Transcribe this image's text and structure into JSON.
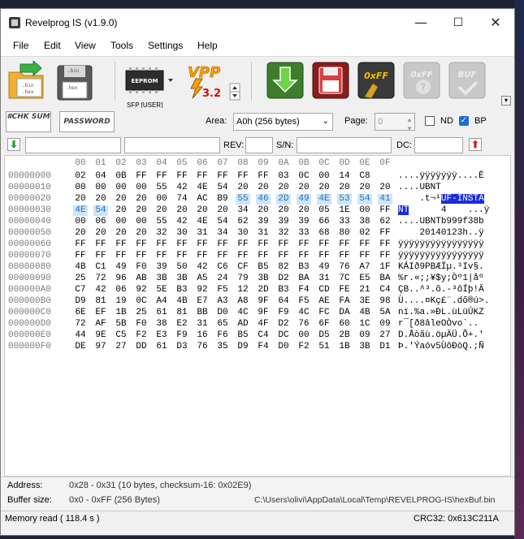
{
  "window": {
    "title": "Revelprog IS (v1.9.0)",
    "minimize": "—",
    "maximize": "☐",
    "close": "✕"
  },
  "menu": [
    "File",
    "Edit",
    "View",
    "Tools",
    "Settings",
    "Help"
  ],
  "toolbar": {
    "open_text": "Open",
    "save_text": "Save",
    "chip_label": "EEPROM",
    "chip_selection": "SFP [USER]",
    "vpp_label": "VPP",
    "vpp_value": "3.2",
    "ff_label": "0xFF",
    "ffd_label": "0xFF",
    "buf_label": "BUF"
  },
  "controls": {
    "checksum_btn": "#CHK SUM",
    "password_btn": "PASSWORD",
    "area_label": "Area:",
    "area_value": "A0h (256 bytes)",
    "page_label": "Page:",
    "page_value": "0",
    "nd_label": "ND",
    "bp_label": "BP",
    "rev_label": "REV:",
    "sn_label": "S/N:",
    "dc_label": "DC:"
  },
  "hex": {
    "columns": [
      "00",
      "01",
      "02",
      "03",
      "04",
      "05",
      "06",
      "07",
      "08",
      "09",
      "0A",
      "0B",
      "0C",
      "0D",
      "0E",
      "0F"
    ],
    "selection_start": 40,
    "selection_end": 49,
    "rows": [
      {
        "addr": "00000000",
        "bytes": [
          "02",
          "04",
          "0B",
          "FF",
          "FF",
          "FF",
          "FF",
          "FF",
          "FF",
          "FF",
          "03",
          "0C",
          "00",
          "14",
          "C8",
          ""
        ]
      },
      {
        "addr": "00000010",
        "bytes": [
          "00",
          "00",
          "00",
          "00",
          "55",
          "42",
          "4E",
          "54",
          "20",
          "20",
          "20",
          "20",
          "20",
          "20",
          "20",
          "20"
        ]
      },
      {
        "addr": "00000020",
        "bytes": [
          "20",
          "20",
          "20",
          "20",
          "00",
          "74",
          "AC",
          "B9",
          "55",
          "46",
          "2D",
          "49",
          "4E",
          "53",
          "54",
          "41"
        ]
      },
      {
        "addr": "00000030",
        "bytes": [
          "4E",
          "54",
          "20",
          "20",
          "20",
          "20",
          "20",
          "20",
          "34",
          "20",
          "20",
          "20",
          "05",
          "1E",
          "00",
          "FF"
        ]
      },
      {
        "addr": "00000040",
        "bytes": [
          "00",
          "06",
          "00",
          "00",
          "55",
          "42",
          "4E",
          "54",
          "62",
          "39",
          "39",
          "39",
          "66",
          "33",
          "38",
          "62"
        ]
      },
      {
        "addr": "00000050",
        "bytes": [
          "20",
          "20",
          "20",
          "20",
          "32",
          "30",
          "31",
          "34",
          "30",
          "31",
          "32",
          "33",
          "68",
          "80",
          "02",
          "FF"
        ]
      },
      {
        "addr": "00000060",
        "bytes": [
          "FF",
          "FF",
          "FF",
          "FF",
          "FF",
          "FF",
          "FF",
          "FF",
          "FF",
          "FF",
          "FF",
          "FF",
          "FF",
          "FF",
          "FF",
          "FF"
        ]
      },
      {
        "addr": "00000070",
        "bytes": [
          "FF",
          "FF",
          "FF",
          "FF",
          "FF",
          "FF",
          "FF",
          "FF",
          "FF",
          "FF",
          "FF",
          "FF",
          "FF",
          "FF",
          "FF",
          "FF"
        ]
      },
      {
        "addr": "00000080",
        "bytes": [
          "4B",
          "C1",
          "49",
          "F0",
          "39",
          "50",
          "42",
          "C6",
          "CF",
          "B5",
          "82",
          "B3",
          "49",
          "76",
          "A7",
          "1F"
        ]
      },
      {
        "addr": "00000090",
        "bytes": [
          "25",
          "72",
          "96",
          "AB",
          "3B",
          "3B",
          "A5",
          "24",
          "79",
          "3B",
          "D2",
          "BA",
          "31",
          "7C",
          "E5",
          "BA"
        ]
      },
      {
        "addr": "000000A0",
        "bytes": [
          "C7",
          "42",
          "06",
          "92",
          "5E",
          "B3",
          "92",
          "F5",
          "12",
          "2D",
          "B3",
          "F4",
          "CD",
          "FE",
          "21",
          "C4"
        ]
      },
      {
        "addr": "000000B0",
        "bytes": [
          "D9",
          "81",
          "19",
          "0C",
          "A4",
          "4B",
          "E7",
          "A3",
          "A8",
          "9F",
          "64",
          "F5",
          "AE",
          "FA",
          "3E",
          "98"
        ]
      },
      {
        "addr": "000000C0",
        "bytes": [
          "6E",
          "EF",
          "1B",
          "25",
          "61",
          "81",
          "BB",
          "D0",
          "4C",
          "9F",
          "F9",
          "4C",
          "FC",
          "DA",
          "4B",
          "5A"
        ]
      },
      {
        "addr": "000000D0",
        "bytes": [
          "72",
          "AF",
          "5B",
          "F0",
          "38",
          "E2",
          "31",
          "65",
          "AD",
          "4F",
          "D2",
          "76",
          "6F",
          "60",
          "1C",
          "09"
        ]
      },
      {
        "addr": "000000E0",
        "bytes": [
          "44",
          "9E",
          "C5",
          "F2",
          "E3",
          "F9",
          "16",
          "F6",
          "B5",
          "C4",
          "DC",
          "00",
          "D5",
          "2B",
          "09",
          "27"
        ]
      },
      {
        "addr": "000000F0",
        "bytes": [
          "DE",
          "97",
          "27",
          "DD",
          "61",
          "D3",
          "76",
          "35",
          "D9",
          "F4",
          "D0",
          "F2",
          "51",
          "1B",
          "3B",
          "D1"
        ]
      }
    ],
    "ascii": [
      "....ÿÿÿÿÿÿÿ....È",
      "....UBNT        ",
      "    .t¬¹UF-INSTA",
      "NT      4    ...ÿ",
      "....UBNTb999f38b",
      "    20140123h..ÿ",
      "ÿÿÿÿÿÿÿÿÿÿÿÿÿÿÿÿ",
      "ÿÿÿÿÿÿÿÿÿÿÿÿÿÿÿÿ",
      "KÁIð9PBÆÏµ.³Iv§.",
      "%r.«;;¥$y;Òº1|åº",
      "ÇB..^³.õ.-³ôÍþ!Ä",
      "Ù....¤Kç£¨.dõ®ú>.",
      "nï.%a.»ÐL.ùLüÚKZ",
      "r¯[ð8âle­OÒvo`..",
      "D.Åòãù.öµÄÜ.Õ+.'",
      "Þ.'Ýaóv5ÙôÐòQ.;Ñ"
    ]
  },
  "info": {
    "address_label": "Address:",
    "address_value": "0x28 - 0x31 (10 bytes, checksum-16: 0x02E9)",
    "bufsize_label": "Buffer size:",
    "bufsize_value": "0x0 - 0xFF (256 Bytes)",
    "path": "C:\\Users\\olivi\\AppData\\Local\\Temp\\REVELPROG-IS\\hexBuf.bin"
  },
  "status": {
    "left": "Memory read ( 118.4 s )",
    "crc": "CRC32: 0x613C211A"
  },
  "colors": {
    "selection_bg": "#cfe5f7",
    "selection_fg": "#1e70c8",
    "ascii_sel": "#1a2dd8",
    "cursor": "#ffeb3b"
  }
}
